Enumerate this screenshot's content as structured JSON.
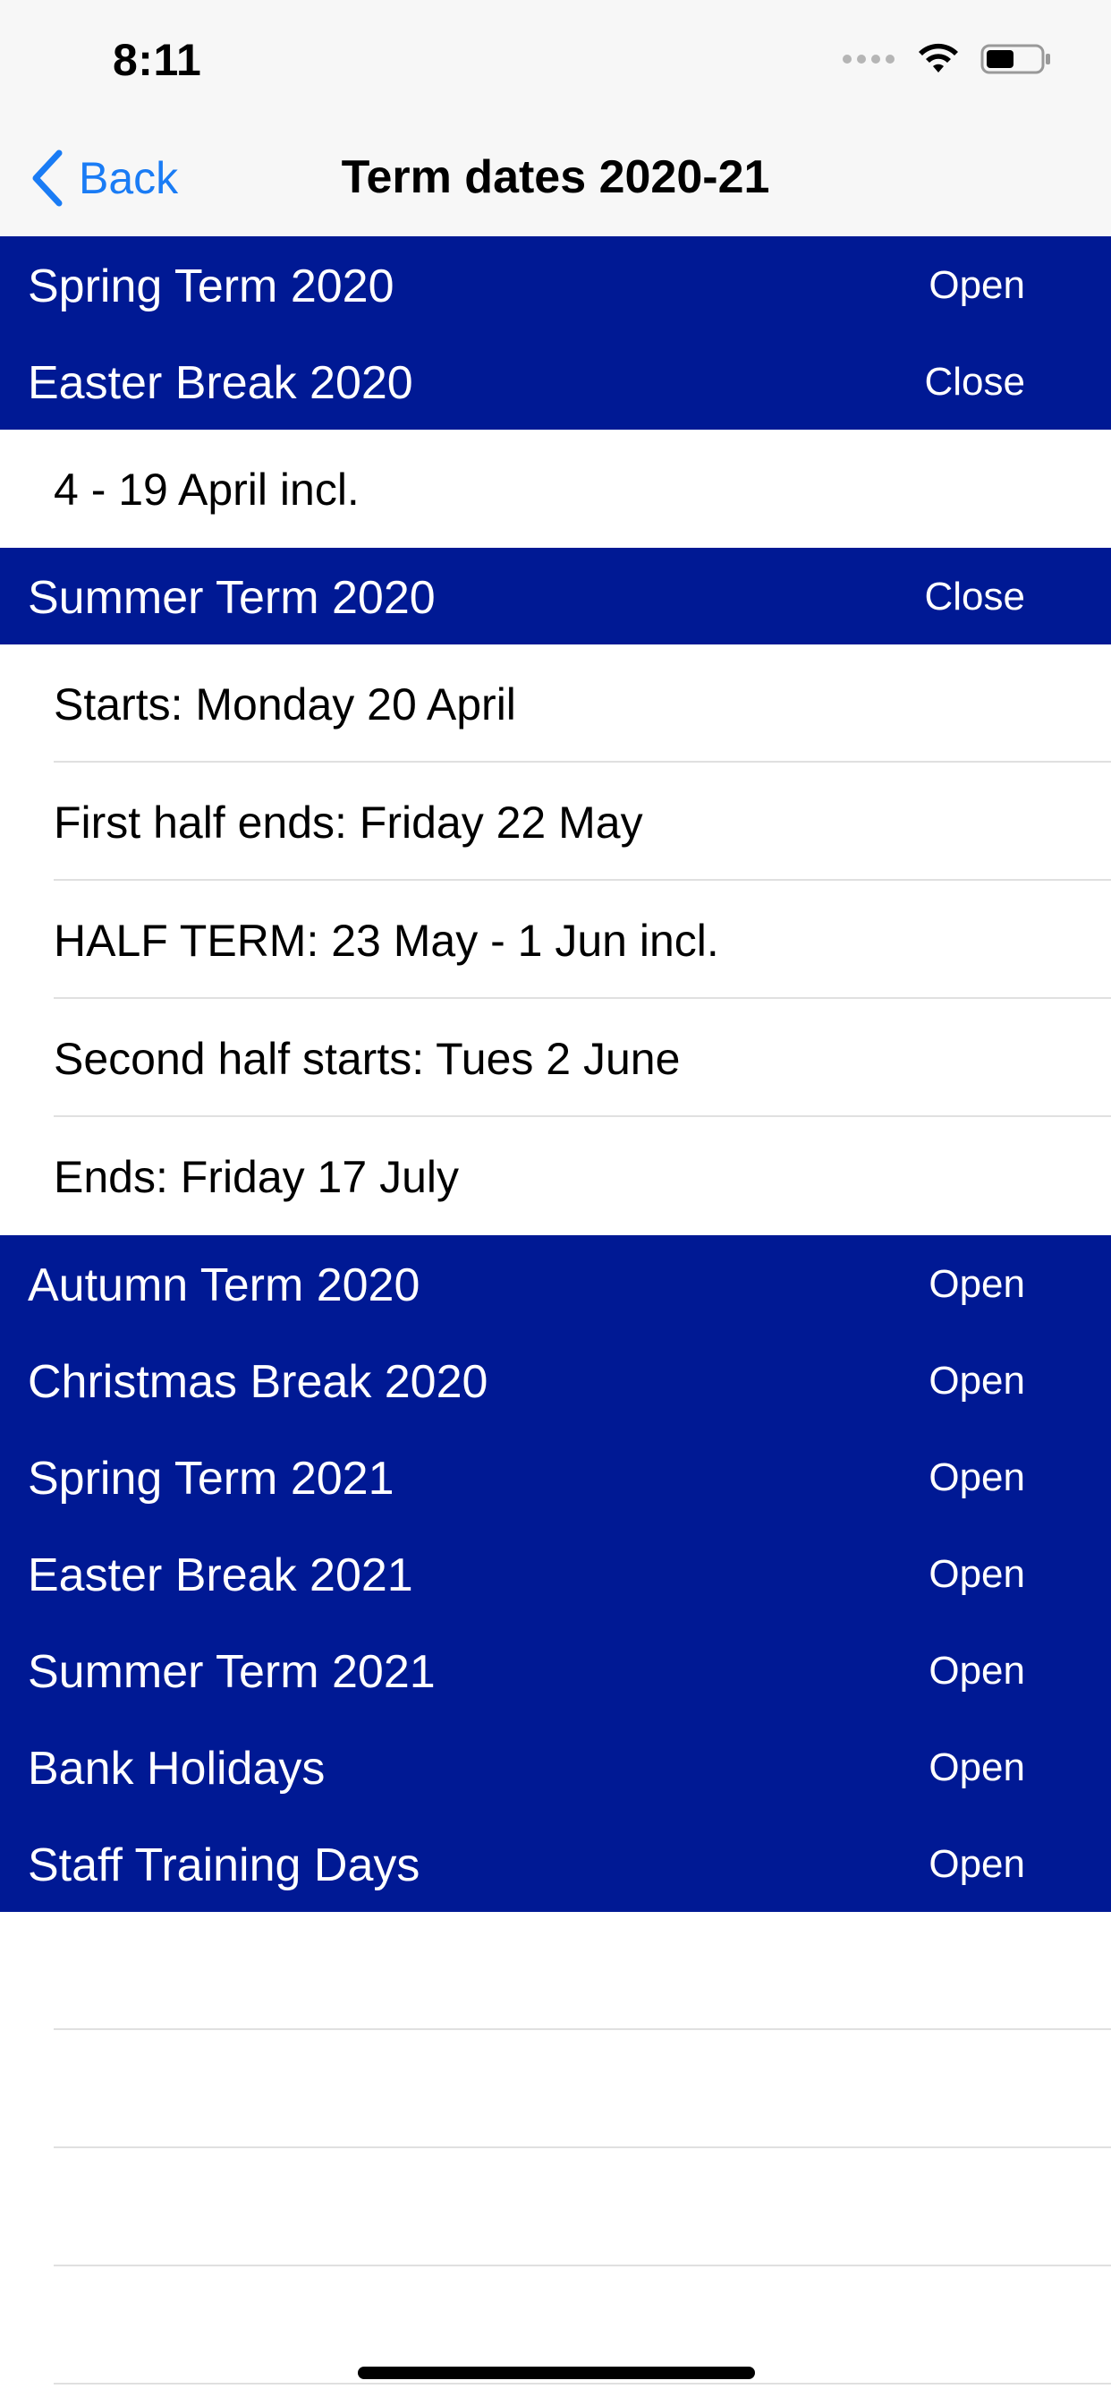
{
  "status_bar": {
    "time": "8:11",
    "icons": [
      "signal-dots-icon",
      "wifi-icon",
      "battery-icon"
    ]
  },
  "nav": {
    "back_label": "Back",
    "title": "Term dates 2020-21"
  },
  "colors": {
    "header_bg": "#001994",
    "accent": "#1a7cf5",
    "bar_bg": "#f7f7f7"
  },
  "sections": [
    {
      "title": "Spring Term 2020",
      "toggle": "Open",
      "rows": []
    },
    {
      "title": "Easter Break 2020",
      "toggle": "Close",
      "rows": [
        "4 - 19 April incl."
      ]
    },
    {
      "title": "Summer Term 2020",
      "toggle": "Close",
      "rows": [
        "Starts: Monday 20 April",
        "First half ends: Friday 22 May",
        "HALF TERM: 23 May - 1 Jun incl.",
        "Second half starts: Tues 2 June",
        "Ends: Friday 17 July"
      ]
    },
    {
      "title": "Autumn Term 2020",
      "toggle": "Open",
      "rows": []
    },
    {
      "title": "Christmas Break 2020",
      "toggle": "Open",
      "rows": []
    },
    {
      "title": "Spring Term 2021",
      "toggle": "Open",
      "rows": []
    },
    {
      "title": "Easter Break 2021",
      "toggle": "Open",
      "rows": []
    },
    {
      "title": "Summer Term 2021",
      "toggle": "Open",
      "rows": []
    },
    {
      "title": "Bank Holidays",
      "toggle": "Open",
      "rows": []
    },
    {
      "title": "Staff Training Days",
      "toggle": "Open",
      "rows": []
    }
  ]
}
